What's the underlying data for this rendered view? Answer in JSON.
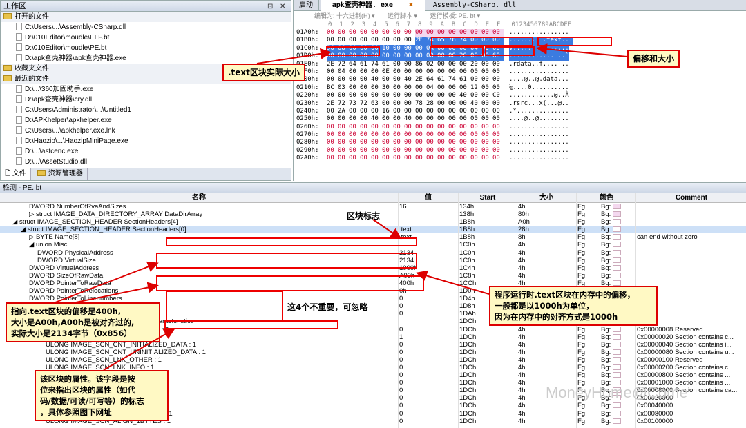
{
  "workspace": {
    "title": "工作区",
    "groups": [
      {
        "label": "打开的文件",
        "files": [
          "C:\\Users\\...\\Assembly-CSharp.dll",
          "D:\\010Editor\\moudle\\ELF.bt",
          "D:\\010Editor\\moudle\\PE.bt",
          "D:\\apk查壳神器\\apk查壳神器.exe"
        ]
      },
      {
        "label": "收藏夹文件",
        "files": []
      },
      {
        "label": "最近的文件",
        "files": [
          "D:\\...\\360加固助手.exe",
          "D:\\apk查壳神器\\cry.dll",
          "C:\\Users\\Administrator\\...\\Untitled1",
          "D:\\APKhelper\\apkhelper.exe",
          "C:\\Users\\...\\apkhelper.exe.lnk",
          "D:\\Haozip\\...\\HaozipMiniPage.exe",
          "D:\\...\\astcenc.exe",
          "D:\\...\\AssetStudio.dll"
        ]
      }
    ],
    "bottom_tabs": [
      "文件",
      "资源管理器"
    ]
  },
  "hex": {
    "tabs": [
      "启动",
      "apk查壳神器. exe",
      "Assembly-CSharp. dll"
    ],
    "toolbar": [
      "编辑为: 十六进制(H) ▾",
      "运行脚本 ▾",
      "运行模板: PE. bt ▾"
    ],
    "col_header": "0  1  2  3  4  5  6  7  8  9  A  B  C  D  E  F   0123456789ABCDEF",
    "rows": [
      {
        "addr": "01A0h:",
        "bytes": [
          "00",
          "00",
          "00",
          "00",
          "00",
          "00",
          "00",
          "00",
          "00",
          "00",
          "00",
          "00",
          "00",
          "00",
          "00",
          "00"
        ],
        "ascii": "................"
      },
      {
        "addr": "01B0h:",
        "bytes": [
          "00",
          "00",
          "00",
          "00",
          "00",
          "00",
          "00",
          "00",
          "2E",
          "74",
          "65",
          "78",
          "74",
          "00",
          "00",
          "00"
        ],
        "ascii": "........ .text..."
      },
      {
        "addr": "01C0h:",
        "bytes": [
          "56",
          "08",
          "00",
          "00",
          "00",
          "10",
          "00",
          "00",
          "00",
          "0A",
          "00",
          "00",
          "00",
          "04",
          "00",
          "00"
        ],
        "ascii": "V..............."
      },
      {
        "addr": "01D0h:",
        "bytes": [
          "00",
          "00",
          "00",
          "00",
          "00",
          "00",
          "00",
          "00",
          "00",
          "00",
          "00",
          "00",
          "20",
          "00",
          "00",
          "60"
        ],
        "ascii": "............ ..`"
      },
      {
        "addr": "01E0h:",
        "bytes": [
          "2E",
          "72",
          "64",
          "61",
          "74",
          "61",
          "00",
          "00",
          "86",
          "02",
          "00",
          "00",
          "00",
          "20",
          "00",
          "00"
        ],
        "ascii": ".rdata..†.... .."
      },
      {
        "addr": "01F0h:",
        "bytes": [
          "00",
          "04",
          "00",
          "00",
          "00",
          "0E",
          "00",
          "00",
          "00",
          "00",
          "00",
          "00",
          "00",
          "00",
          "00",
          "00"
        ],
        "ascii": "................"
      },
      {
        "addr": "0200h:",
        "bytes": [
          "00",
          "00",
          "00",
          "00",
          "40",
          "00",
          "00",
          "40",
          "2E",
          "64",
          "61",
          "74",
          "61",
          "00",
          "00",
          "00"
        ],
        "ascii": "....@..@.data..."
      },
      {
        "addr": "0210h:",
        "bytes": [
          "BC",
          "03",
          "00",
          "00",
          "00",
          "30",
          "00",
          "00",
          "00",
          "04",
          "00",
          "00",
          "00",
          "12",
          "00",
          "00"
        ],
        "ascii": "¼....0.........."
      },
      {
        "addr": "0220h:",
        "bytes": [
          "00",
          "00",
          "00",
          "00",
          "00",
          "00",
          "00",
          "00",
          "00",
          "00",
          "00",
          "00",
          "40",
          "00",
          "00",
          "C0"
        ],
        "ascii": "............@..À"
      },
      {
        "addr": "0230h:",
        "bytes": [
          "2E",
          "72",
          "73",
          "72",
          "63",
          "00",
          "00",
          "00",
          "78",
          "28",
          "00",
          "00",
          "00",
          "40",
          "00",
          "00"
        ],
        "ascii": ".rsrc...x(...@.."
      },
      {
        "addr": "0240h:",
        "bytes": [
          "00",
          "2A",
          "00",
          "00",
          "00",
          "16",
          "00",
          "00",
          "00",
          "00",
          "00",
          "00",
          "00",
          "00",
          "00",
          "00"
        ],
        "ascii": ".*.............."
      },
      {
        "addr": "0250h:",
        "bytes": [
          "00",
          "00",
          "00",
          "00",
          "40",
          "00",
          "00",
          "40",
          "00",
          "00",
          "00",
          "00",
          "00",
          "00",
          "00",
          "00"
        ],
        "ascii": "....@..@........"
      },
      {
        "addr": "0260h:",
        "bytes": [
          "00",
          "00",
          "00",
          "00",
          "00",
          "00",
          "00",
          "00",
          "00",
          "00",
          "00",
          "00",
          "00",
          "00",
          "00",
          "00"
        ],
        "ascii": "................"
      },
      {
        "addr": "0270h:",
        "bytes": [
          "00",
          "00",
          "00",
          "00",
          "00",
          "00",
          "00",
          "00",
          "00",
          "00",
          "00",
          "00",
          "00",
          "00",
          "00",
          "00"
        ],
        "ascii": "................"
      },
      {
        "addr": "0280h:",
        "bytes": [
          "00",
          "00",
          "00",
          "00",
          "00",
          "00",
          "00",
          "00",
          "00",
          "00",
          "00",
          "00",
          "00",
          "00",
          "00",
          "00"
        ],
        "ascii": "................"
      },
      {
        "addr": "0290h:",
        "bytes": [
          "00",
          "00",
          "00",
          "00",
          "00",
          "00",
          "00",
          "00",
          "00",
          "00",
          "00",
          "00",
          "00",
          "00",
          "00",
          "00"
        ],
        "ascii": "................"
      },
      {
        "addr": "02A0h:",
        "bytes": [
          "00",
          "00",
          "00",
          "00",
          "00",
          "00",
          "00",
          "00",
          "00",
          "00",
          "00",
          "00",
          "00",
          "00",
          "00",
          "00"
        ],
        "ascii": "................"
      }
    ]
  },
  "inspector": {
    "title": "检测 - PE. bt",
    "headers": {
      "name": "名称",
      "value": "值",
      "start": "Start",
      "size": "大小",
      "color": "颜色",
      "comment": "Comment"
    },
    "rows": [
      {
        "name": "DWORD NumberOfRvaAndSizes",
        "indent": 3,
        "value": "16",
        "start": "134h",
        "size": "4h",
        "fg": "Fg:",
        "bg": "Bg:",
        "comment": "",
        "sw": true
      },
      {
        "name": "▷ struct IMAGE_DATA_DIRECTORY_ARRAY DataDirArray",
        "indent": 3,
        "value": "",
        "start": "138h",
        "size": "80h",
        "fg": "Fg:",
        "bg": "Bg:",
        "comment": "",
        "sw": true
      },
      {
        "name": "◢ struct IMAGE_SECTION_HEADER SectionHeaders[4]",
        "indent": 1,
        "value": "",
        "start": "1B8h",
        "size": "A0h",
        "fg": "Fg:",
        "bg": "Bg:",
        "comment": "",
        "sw": false
      },
      {
        "name": "◢ struct IMAGE_SECTION_HEADER SectionHeaders[0]",
        "indent": 2,
        "value": ".text",
        "start": "1B8h",
        "size": "28h",
        "fg": "Fg:",
        "bg": "Bg:",
        "comment": "",
        "sw": false,
        "hl": true
      },
      {
        "name": "▷ BYTE Name[8]",
        "indent": 3,
        "value": ".text",
        "start": "1B8h",
        "size": "8h",
        "fg": "Fg:",
        "bg": "Bg:",
        "comment": "can end without zero",
        "sw": false
      },
      {
        "name": "◢ union Misc",
        "indent": 3,
        "value": "",
        "start": "1C0h",
        "size": "4h",
        "fg": "Fg:",
        "bg": "Bg:",
        "comment": "",
        "sw": false
      },
      {
        "name": "DWORD PhysicalAddress",
        "indent": 4,
        "value": "2134",
        "start": "1C0h",
        "size": "4h",
        "fg": "Fg:",
        "bg": "Bg:",
        "comment": "",
        "sw": false
      },
      {
        "name": "DWORD VirtualSize",
        "indent": 4,
        "value": "2134",
        "start": "1C0h",
        "size": "4h",
        "fg": "Fg:",
        "bg": "Bg:",
        "comment": "",
        "sw": false
      },
      {
        "name": "DWORD VirtualAddress",
        "indent": 3,
        "value": "1000h",
        "start": "1C4h",
        "size": "4h",
        "fg": "Fg:",
        "bg": "Bg:",
        "comment": "",
        "sw": false
      },
      {
        "name": "DWORD SizeOfRawData",
        "indent": 3,
        "value": "A00h",
        "start": "1C8h",
        "size": "4h",
        "fg": "Fg:",
        "bg": "Bg:",
        "comment": "",
        "sw": false
      },
      {
        "name": "DWORD PointerToRawData",
        "indent": 3,
        "value": "400h",
        "start": "1CCh",
        "size": "4h",
        "fg": "Fg:",
        "bg": "Bg:",
        "comment": "",
        "sw": false
      },
      {
        "name": "DWORD PointerToRelocations",
        "indent": 3,
        "value": "0h",
        "start": "1D0h",
        "size": "4h",
        "fg": "Fg:",
        "bg": "Bg:",
        "comment": "",
        "sw": false
      },
      {
        "name": "DWORD PointerToLinenumbers",
        "indent": 3,
        "value": "0",
        "start": "1D4h",
        "size": "4h",
        "fg": "Fg:",
        "bg": "Bg:",
        "comment": "",
        "sw": false
      },
      {
        "name": "WORD NumberOfRelocations",
        "indent": 3,
        "value": "0",
        "start": "1D8h",
        "size": "2h",
        "fg": "Fg:",
        "bg": "Bg:",
        "comment": "",
        "sw": false
      },
      {
        "name": "WORD NumberOfLinenumbers",
        "indent": 3,
        "value": "0",
        "start": "1DAh",
        "size": "2h",
        "fg": "Fg:",
        "bg": "Bg:",
        "comment": "",
        "sw": false
      },
      {
        "name": "◢ struct SECTION_CHARACTERISTICS Characteristics",
        "indent": 3,
        "value": "",
        "start": "1DCh",
        "size": "4h",
        "fg": "Fg:",
        "bg": "Bg:",
        "comment": "",
        "sw": false
      },
      {
        "name": "ULONG IMAGE_SCN_TYPE_NO_PAD : 1",
        "indent": 5,
        "value": "0",
        "start": "1DCh",
        "size": "4h",
        "fg": "Fg:",
        "bg": "Bg:",
        "comment": "0x00000008 Reserved",
        "sw": false
      },
      {
        "name": "ULONG IMAGE_SCN_CNT_CODE : 1",
        "indent": 5,
        "value": "1",
        "start": "1DCh",
        "size": "4h",
        "fg": "Fg:",
        "bg": "Bg:",
        "comment": "0x00000020 Section contains c...",
        "sw": false
      },
      {
        "name": "ULONG IMAGE_SCN_CNT_INITIALIZED_DATA : 1",
        "indent": 5,
        "value": "0",
        "start": "1DCh",
        "size": "4h",
        "fg": "Fg:",
        "bg": "Bg:",
        "comment": "0x00000040 Section contains i...",
        "sw": false
      },
      {
        "name": "ULONG IMAGE_SCN_CNT_UNINITIALIZED_DATA : 1",
        "indent": 5,
        "value": "0",
        "start": "1DCh",
        "size": "4h",
        "fg": "Fg:",
        "bg": "Bg:",
        "comment": "0x00000080 Section contains u...",
        "sw": false
      },
      {
        "name": "ULONG IMAGE_SCN_LNK_OTHER : 1",
        "indent": 5,
        "value": "0",
        "start": "1DCh",
        "size": "4h",
        "fg": "Fg:",
        "bg": "Bg:",
        "comment": "0x00000100 Reserved",
        "sw": false
      },
      {
        "name": "ULONG IMAGE_SCN_LNK_INFO : 1",
        "indent": 5,
        "value": "0",
        "start": "1DCh",
        "size": "4h",
        "fg": "Fg:",
        "bg": "Bg:",
        "comment": "0x00000200 Section contains c...",
        "sw": false
      },
      {
        "name": "ULONG IMAGE_SCN_LNK_REMOVE : 1",
        "indent": 5,
        "value": "0",
        "start": "1DCh",
        "size": "4h",
        "fg": "Fg:",
        "bg": "Bg:",
        "comment": "0x00000800 Section contains ...",
        "sw": false
      },
      {
        "name": "ULONG IMAGE_SCN_LNK_COMDAT : 1",
        "indent": 5,
        "value": "0",
        "start": "1DCh",
        "size": "4h",
        "fg": "Fg:",
        "bg": "Bg:",
        "comment": "0x00001000 Section contains ...",
        "sw": false
      },
      {
        "name": "ULONG IMAGE_SCN_GPREL : 1",
        "indent": 5,
        "value": "0",
        "start": "1DCh",
        "size": "4h",
        "fg": "Fg:",
        "bg": "Bg:",
        "comment": "0x00008000 Section contains ca...",
        "sw": false
      },
      {
        "name": "ULONG IMAGE_SCN_MEM_16BIT : 1",
        "indent": 5,
        "value": "0",
        "start": "1DCh",
        "size": "4h",
        "fg": "Fg:",
        "bg": "Bg:",
        "comment": "0x00020000",
        "sw": false
      },
      {
        "name": "ULONG IMAGE_SCN_MEM_LOCKED : 1",
        "indent": 5,
        "value": "0",
        "start": "1DCh",
        "size": "4h",
        "fg": "Fg:",
        "bg": "Bg:",
        "comment": "0x00040000",
        "sw": false
      },
      {
        "name": "ULONG IMAGE_SCN_MEM_PRELOAD : 1",
        "indent": 5,
        "value": "0",
        "start": "1DCh",
        "size": "4h",
        "fg": "Fg:",
        "bg": "Bg:",
        "comment": "0x00080000",
        "sw": false
      },
      {
        "name": "ULONG IMAGE_SCN_ALIGN_1BYTES : 1",
        "indent": 5,
        "value": "0",
        "start": "1DCh",
        "size": "4h",
        "fg": "Fg:",
        "bg": "Bg:",
        "comment": "0x00100000",
        "sw": false
      }
    ]
  },
  "annotations": {
    "text_size": ".text区块实际大小",
    "offset_size": "偏移和大小",
    "section_flag": "区块标志",
    "ignore": "这4个不重要，可忽略",
    "vaddr_note": "程序运行时.text区块在内存中的偏移，\n一般都是以1000h为单位，\n因为在内存中的对齐方式是1000h",
    "raw_note": "指向.text区块的偏移是400h,\n大小是A00h,A00h是被对齐过的,\n实际大小是2134字节（0x856）",
    "charac_note": "该区块的属性。该字段是按\n位来指出区块的属性（如代\n码/数据/可读/可写等）的标志\n，具体参照图下网址",
    "watermark": "MoneyHome@Come"
  },
  "colors": {
    "accent": "#3b7be0",
    "annotation_red": "#dd0000",
    "highlight_pink": "#f4d8ef"
  }
}
